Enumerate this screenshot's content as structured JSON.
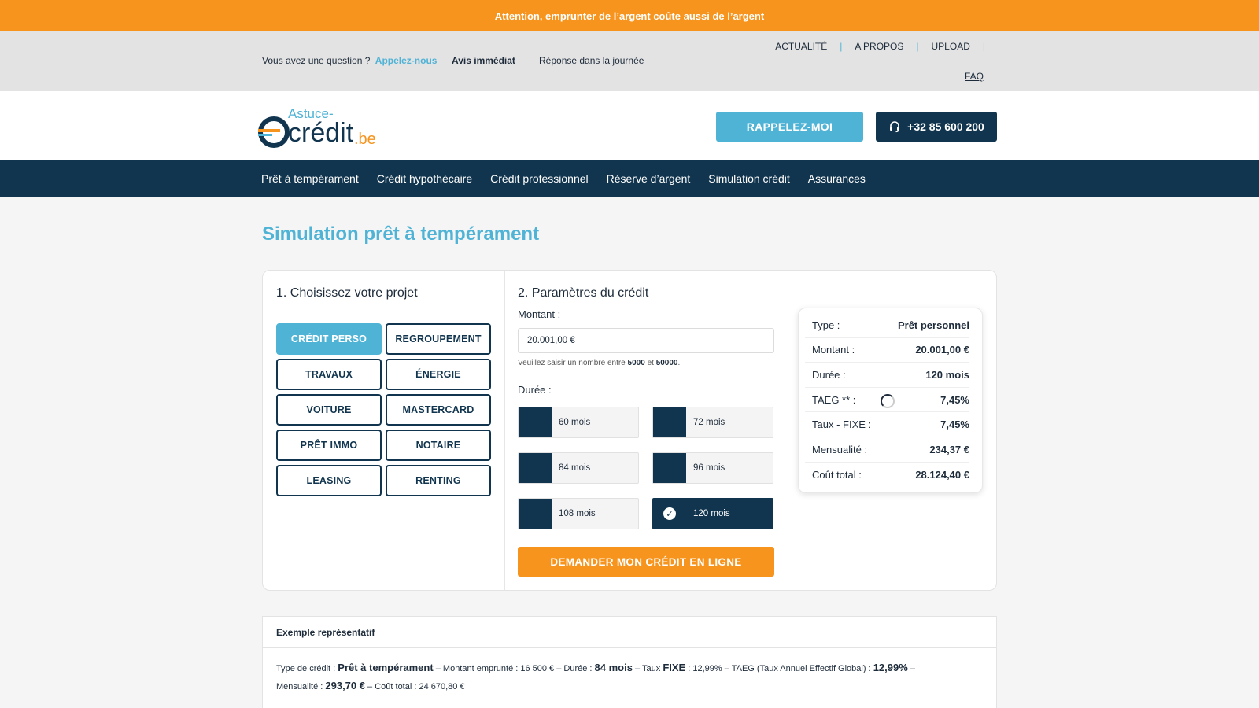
{
  "warning": "Attention, emprunter de l’argent coûte aussi de l’argent",
  "topbar": {
    "question": "Vous avez une question ?",
    "call_link": "Appelez-nous",
    "avis": "Avis immédiat",
    "reponse": "Réponse dans la journée",
    "links": [
      "ACTUALITÉ",
      "A PROPOS",
      "UPLOAD"
    ],
    "faq": "FAQ"
  },
  "header": {
    "logo_top": "Astuce-",
    "logo_main": "crédit",
    "logo_tld": ".be",
    "callback_button": "RAPPELEZ-MOI",
    "phone_button": "+32 85 600 200"
  },
  "nav": [
    "Prêt à tempérament",
    "Crédit hypothécaire",
    "Crédit professionnel",
    "Réserve d’argent",
    "Simulation crédit",
    "Assurances"
  ],
  "page_title": "Simulation prêt à tempérament",
  "project": {
    "title": "1. Choisissez votre projet",
    "buttons": [
      "CRÉDIT PERSO",
      "REGROUPEMENT",
      "TRAVAUX",
      "ÉNERGIE",
      "VOITURE",
      "MASTERCARD",
      "PRÊT IMMO",
      "NOTAIRE",
      "LEASING",
      "RENTING"
    ]
  },
  "params": {
    "title": "2. Paramètres du crédit",
    "amount_label": "Montant :",
    "amount_value": "20.001,00 €",
    "hint_prefix": "Veuillez saisir un nombre entre",
    "hint_min": "5000",
    "hint_and": "et",
    "hint_max": "50000",
    "duration_label": "Durée :",
    "durations": [
      "60 mois",
      "72 mois",
      "84 mois",
      "96 mois",
      "108 mois",
      "120 mois"
    ],
    "cta": "DEMANDER MON CRÉDIT EN LIGNE"
  },
  "summary": [
    {
      "k": "Type :",
      "v": "Prêt personnel"
    },
    {
      "k": "Montant :",
      "v": "20.001,00 €"
    },
    {
      "k": "Durée :",
      "v": "120 mois"
    },
    {
      "k": "TAEG ** :",
      "v": "7,45%"
    },
    {
      "k": "Taux - FIXE :",
      "v": "7,45%"
    },
    {
      "k": "Mensualité :",
      "v": "234,37 €"
    },
    {
      "k": "Coût total :",
      "v": "28.124,40 €"
    }
  ],
  "example": {
    "title": "Exemple représentatif",
    "t1": "Type de crédit :",
    "t1v": "Prêt à tempérament",
    "t2": "– Montant emprunté : 16 500 € – Durée :",
    "t2v": "84 mois",
    "t3": "– Taux",
    "t3v": "FIXE",
    "t4": ": 12,99% – TAEG (Taux Annuel Effectif Global) :",
    "t4v": "12,99%",
    "t5": "–",
    "t6": "Mensualité :",
    "t6v": "293,70 €",
    "t7": "– Coût total : 24 670,80 €"
  },
  "colors": {
    "orange": "#f7941d",
    "blue": "#4fb3d6",
    "navy": "#11354f"
  }
}
